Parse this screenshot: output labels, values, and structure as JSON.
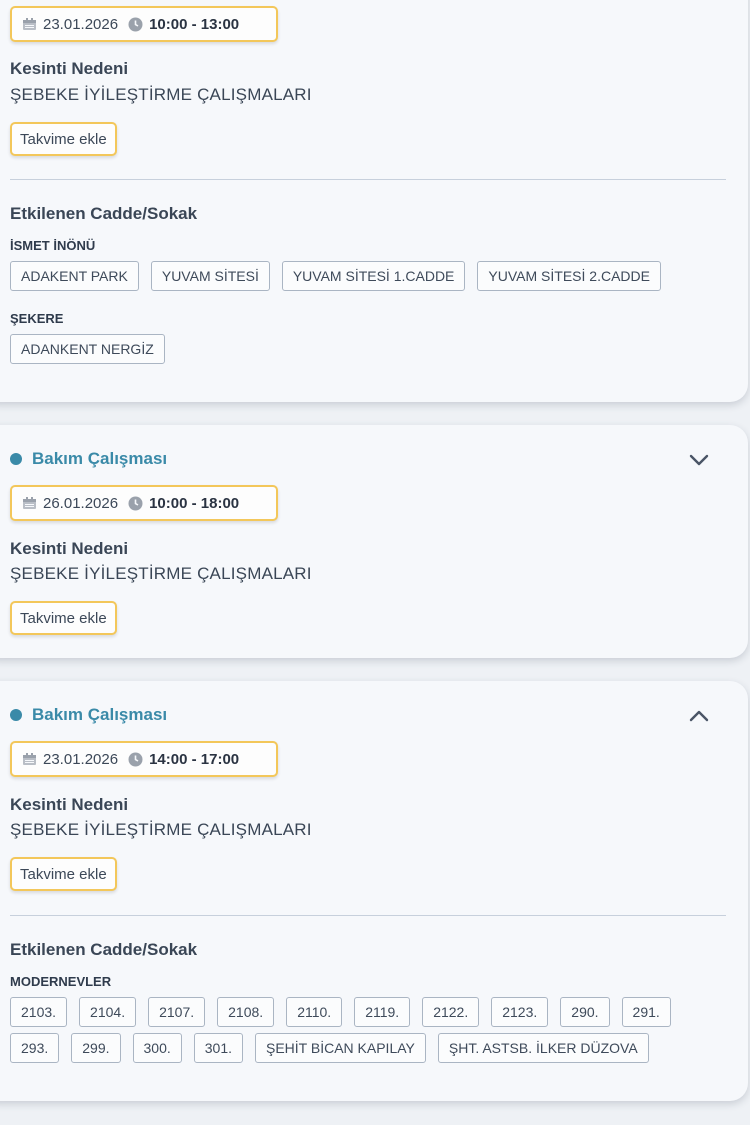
{
  "cards": [
    {
      "date": "23.01.2026",
      "time": "10:00 - 13:00",
      "reason_title": "Kesinti Nedeni",
      "reason_text": "ŞEBEKE İYİLEŞTİRME ÇALIŞMALARI",
      "calendar_label": "Takvime ekle",
      "affected_title": "Etkilenen Cadde/Sokak",
      "groups": [
        {
          "name": "İSMET İNÖNÜ",
          "streets": [
            "ADAKENT PARK",
            "YUVAM SİTESİ",
            "YUVAM SİTESİ 1.CADDE",
            "YUVAM SİTESİ 2.CADDE"
          ]
        },
        {
          "name": "ŞEKERE",
          "streets": [
            "ADANKENT NERGİZ"
          ]
        }
      ]
    },
    {
      "type_label": "Bakım Çalışması",
      "expanded": false,
      "date": "26.01.2026",
      "time": "10:00 - 18:00",
      "reason_title": "Kesinti Nedeni",
      "reason_text": "ŞEBEKE İYİLEŞTİRME ÇALIŞMALARI",
      "calendar_label": "Takvime ekle"
    },
    {
      "type_label": "Bakım Çalışması",
      "expanded": true,
      "date": "23.01.2026",
      "time": "14:00 - 17:00",
      "reason_title": "Kesinti Nedeni",
      "reason_text": "ŞEBEKE İYİLEŞTİRME ÇALIŞMALARI",
      "calendar_label": "Takvime ekle",
      "affected_title": "Etkilenen Cadde/Sokak",
      "groups": [
        {
          "name": "MODERNEVLER",
          "streets_row1": [
            "2103.",
            "2104.",
            "2107.",
            "2108.",
            "2110.",
            "2119.",
            "2122.",
            "2123.",
            "290.",
            "291."
          ],
          "streets_row2": [
            "293.",
            "299.",
            "300.",
            "301.",
            "ŞEHİT BİCAN KAPILAY",
            "ŞHT. ASTSB. İLKER DÜZOVA"
          ]
        }
      ]
    }
  ],
  "icons": {
    "calendar": "calendar-icon",
    "clock": "clock-icon",
    "chevron_down": "chevron-down-icon",
    "chevron_up": "chevron-up-icon",
    "dot": "status-dot-icon"
  },
  "colors": {
    "accent": "#3a8aa8",
    "highlight_border": "#f3c75a",
    "chip_border": "#aab5c3"
  }
}
